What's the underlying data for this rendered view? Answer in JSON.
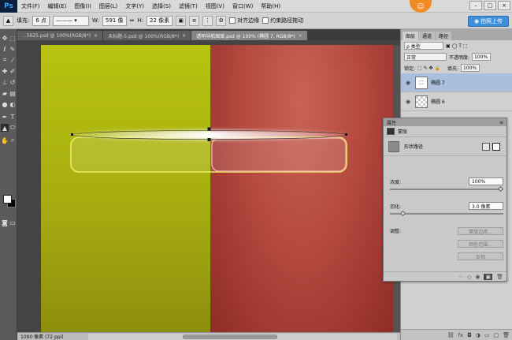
{
  "menubar": {
    "logo": "Ps",
    "items": [
      "文件(F)",
      "编辑(E)",
      "图像(I)",
      "图层(L)",
      "文字(Y)",
      "选择(S)",
      "滤镜(T)",
      "视图(V)",
      "窗口(W)",
      "帮助(H)"
    ],
    "badge": "☺"
  },
  "options": {
    "fill_label": "填充:",
    "stroke_size": "6 点",
    "w_label": "W:",
    "w_value": "591 像",
    "h_label": "H:",
    "h_value": "22 像素",
    "align_edges": "对齐边缘",
    "constrain_path": "约束路径拖动",
    "upload_label": "拍照上传"
  },
  "tabs": [
    {
      "label": "...5625.psd @ 100%(RGB/8*)",
      "active": false
    },
    {
      "label": "未标题-5.psd @ 100%(RGB/8*)",
      "active": false
    },
    {
      "label": "透明导航图案.psd @ 100% (椭圆 7, RGB/8*)",
      "active": true
    }
  ],
  "status": {
    "zoom": "100%",
    "doc_info": "1090 像素 (72 ppi)"
  },
  "layers_panel": {
    "tabs": [
      "图层",
      "通道",
      "路径"
    ],
    "kind_filter": "ρ 类型",
    "blend_mode": "正常",
    "opacity_label": "不透明度:",
    "opacity_value": "100%",
    "lock_label": "锁定:",
    "fill_label": "填充:",
    "fill_value": "100%",
    "layers": [
      {
        "name": "椭圆 7",
        "selected": true
      },
      {
        "name": "椭圆 6",
        "selected": false
      }
    ]
  },
  "properties_panel": {
    "title": "属性",
    "tab_label": "蒙版",
    "mask_type": "形状路径",
    "density_label": "浓度:",
    "density_value": "100%",
    "density": 1.0,
    "feather_label": "羽化:",
    "feather_value": "3.0 像素",
    "feather": 0.1,
    "adjust_label": "调整:",
    "buttons": [
      "蒙版边缘...",
      "颜色范围...",
      "反相"
    ]
  },
  "colors": {
    "canvas_left": "#b5bf10",
    "canvas_right": "#b24a40",
    "accent": "#3f8fd8"
  }
}
